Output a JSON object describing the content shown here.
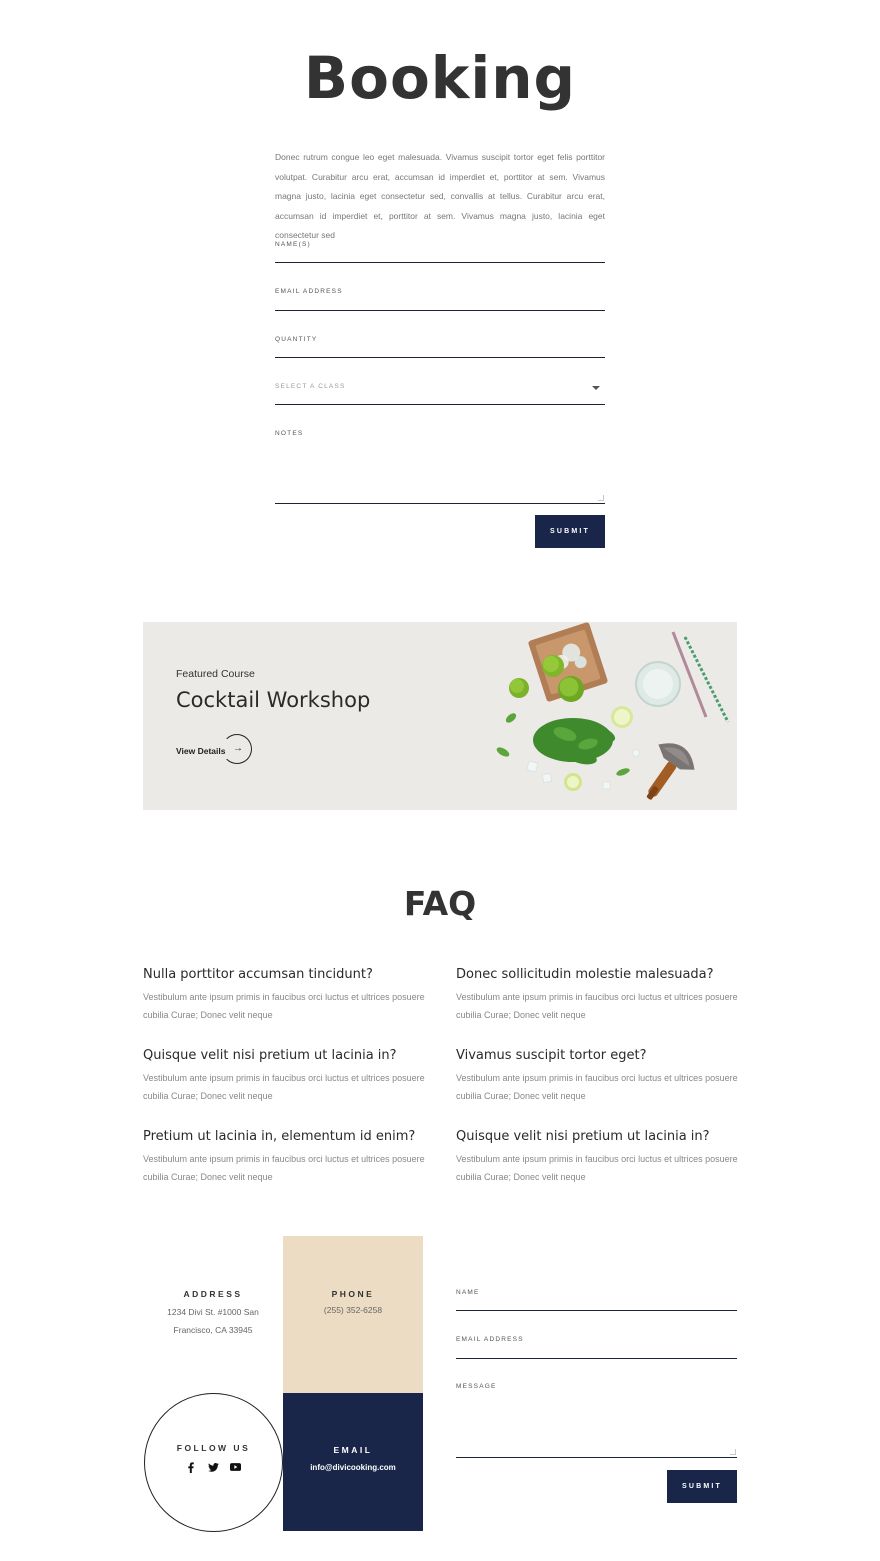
{
  "booking": {
    "title": "Booking",
    "intro": "Donec rutrum congue leo eget malesuada. Vivamus suscipit tortor eget felis porttitor volutpat. Curabitur arcu erat, accumsan id imperdiet et, porttitor at sem. Vivamus magna justo, lacinia eget consectetur sed, convallis at tellus. Curabitur arcu erat, accumsan id imperdiet et, porttitor at sem. Vivamus magna justo, lacinia eget consectetur sed",
    "fields": {
      "names": "NAME(S)",
      "email": "EMAIL ADDRESS",
      "quantity": "QUANTITY",
      "select_class": "SELECT A CLASS",
      "notes": "NOTES"
    },
    "submit_label": "SUBMIT"
  },
  "featured": {
    "kicker": "Featured Course",
    "title": "Cocktail Workshop",
    "link_label": "View Details",
    "link_arrow": "→"
  },
  "faq": {
    "title": "FAQ",
    "items": [
      {
        "q": "Nulla porttitor accumsan tincidunt?",
        "a": "Vestibulum ante ipsum primis in faucibus orci luctus et ultrices posuere cubilia Curae; Donec velit neque"
      },
      {
        "q": "Donec sollicitudin molestie malesuada?",
        "a": "Vestibulum ante ipsum primis in faucibus orci luctus et ultrices posuere cubilia Curae; Donec velit neque"
      },
      {
        "q": "Quisque velit nisi pretium ut lacinia in?",
        "a": "Vestibulum ante ipsum primis in faucibus orci luctus et ultrices posuere cubilia Curae; Donec velit neque"
      },
      {
        "q": "Vivamus suscipit tortor eget?",
        "a": "Vestibulum ante ipsum primis in faucibus orci luctus et ultrices posuere cubilia Curae; Donec velit neque"
      },
      {
        "q": "Pretium ut lacinia in, elementum id enim?",
        "a": "Vestibulum ante ipsum primis in faucibus orci luctus et ultrices posuere cubilia Curae; Donec velit neque"
      },
      {
        "q": "Quisque velit nisi pretium ut lacinia in?",
        "a": "Vestibulum ante ipsum primis in faucibus orci luctus et ultrices posuere cubilia Curae; Donec velit neque"
      }
    ]
  },
  "contact": {
    "address_label": "ADDRESS",
    "address_line1": "1234 Divi St. #1000 San",
    "address_line2": "Francisco, CA 33945",
    "phone_label": "PHONE",
    "phone_value": "(255) 352-6258",
    "follow_label": "FOLLOW US",
    "social_icons": [
      "facebook-icon",
      "twitter-icon",
      "youtube-icon"
    ],
    "email_label": "EMAIL",
    "email_value": "info@divicooking.com"
  },
  "contact_form": {
    "name": "NAME",
    "email": "EMAIL ADDRESS",
    "message": "MESSAGE",
    "submit_label": "SUBMIT"
  },
  "colors": {
    "navy": "#19264a",
    "beige": "#ecdcc3",
    "featured_bg": "#eceae7"
  }
}
